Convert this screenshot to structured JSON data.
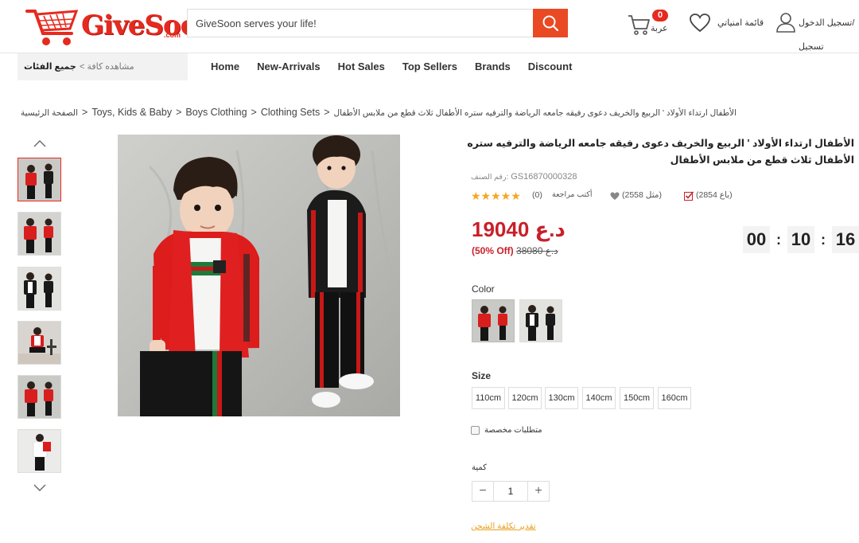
{
  "header": {
    "logo_text": "GiveSoon",
    "logo_suffix": ".com",
    "search_placeholder": "GiveSoon serves your life!",
    "cart_count": "0",
    "cart_label": "عربة",
    "wishlist_label": "قائمة امنياتي",
    "login_label": "تسجيل الدخول/",
    "register_label": "تسجيل"
  },
  "nav": {
    "categories_title": "جميع الفئات",
    "view_all": "< مشاهده كافة",
    "links": [
      "Home",
      "New-Arrivals",
      "Hot Sales",
      "Top Sellers",
      "Brands",
      "Discount"
    ]
  },
  "breadcrumb": {
    "home": "الصفحة الرئيسية",
    "c1": "Toys, Kids & Baby",
    "c2": "Boys Clothing",
    "c3": "Clothing Sets",
    "current": "الأطفال ارتداء الأولاد ' الربيع والخريف دعوى رفيقه جامعه الرياضة والترفيه ستره الأطفال ثلاث قطع من ملابس الأطفال"
  },
  "product": {
    "title": "الأطفال ارتداء الأولاد ' الربيع والخريف دعوى رفيقه جامعه الرياضة والترفيه ستره الأطفال ثلاث قطع من ملابس الأطفال",
    "sku_label": "رقم الصنف:",
    "sku": "GS16870000328",
    "review_count": "(0)",
    "review_label": "أكتب مراجعة",
    "likes": "(2558 مثل)",
    "sold": "(2854 باع)",
    "price": "19040 د.ع",
    "old_price": "38080 د.ع",
    "discount": "(50% Off)",
    "timer": [
      "00",
      "10",
      "16"
    ],
    "color_label": "Color",
    "size_label": "Size",
    "sizes": [
      "110cm",
      "120cm",
      "130cm",
      "140cm",
      "150cm",
      "160cm"
    ],
    "custom_label": "متطلبات مخصصة",
    "qty_label": "كمية",
    "qty_value": "1",
    "qty_minus": "−",
    "qty_plus": "+",
    "shipping_link": "تقدير تكلفة الشحن"
  },
  "colors": {
    "accent": "#e62a1f",
    "price": "#c8202a",
    "search_button": "#e94a24",
    "stars": "#f5a623"
  }
}
